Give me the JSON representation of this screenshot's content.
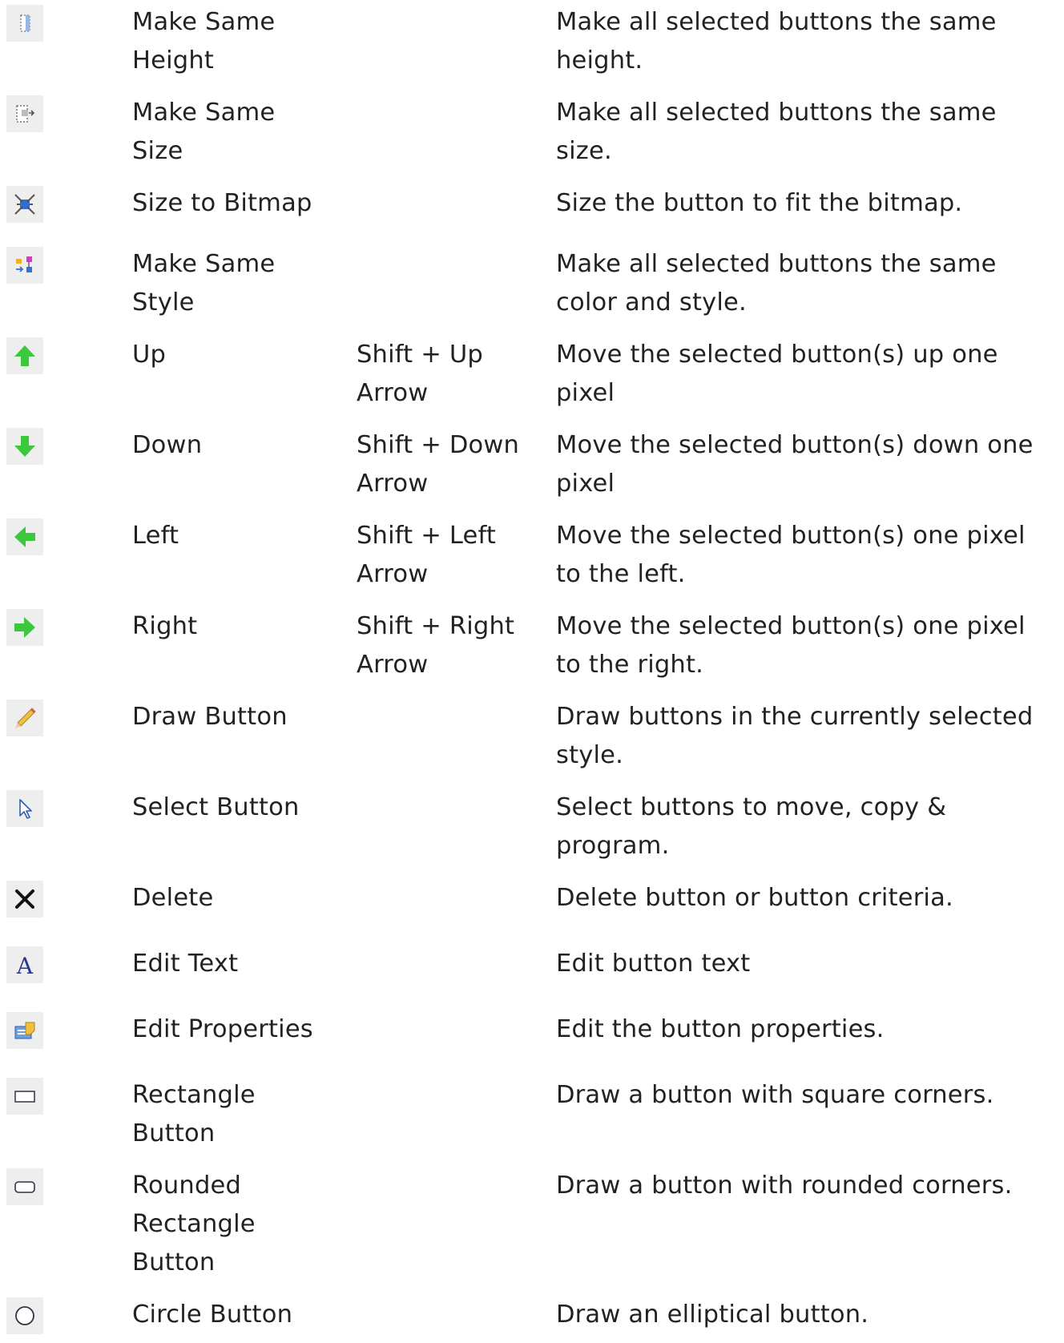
{
  "rows": [
    {
      "icon": "make-same-height-icon",
      "name": "Make Same Height",
      "shortcut": "",
      "description": "Make all selected buttons the same height."
    },
    {
      "icon": "make-same-size-icon",
      "name": "Make Same Size",
      "shortcut": "",
      "description": "Make all selected buttons the same size."
    },
    {
      "icon": "size-to-bitmap-icon",
      "name": "Size to Bitmap",
      "shortcut": "",
      "description": "Size the button to fit the bitmap."
    },
    {
      "icon": "make-same-style-icon",
      "name": "Make Same Style",
      "shortcut": "",
      "description": "Make all selected buttons the same color and style."
    },
    {
      "icon": "arrow-up-icon",
      "name": "Up",
      "shortcut": "Shift + Up Arrow",
      "description": "Move the selected button(s) up one pixel"
    },
    {
      "icon": "arrow-down-icon",
      "name": "Down",
      "shortcut": "Shift + Down Arrow",
      "description": "Move the selected button(s) down one pixel"
    },
    {
      "icon": "arrow-left-icon",
      "name": "Left",
      "shortcut": "Shift + Left Arrow",
      "description": "Move the selected button(s) one pixel to the left."
    },
    {
      "icon": "arrow-right-icon",
      "name": "Right",
      "shortcut": "Shift + Right Arrow",
      "description": "Move the selected button(s) one pixel to the right."
    },
    {
      "icon": "pencil-icon",
      "name": "Draw Button",
      "shortcut": "",
      "description": "Draw buttons in the currently selected style."
    },
    {
      "icon": "pointer-icon",
      "name": "Select Button",
      "shortcut": "",
      "description": "Select buttons to move, copy & program."
    },
    {
      "icon": "delete-x-icon",
      "name": "Delete",
      "shortcut": "",
      "description": "Delete button or button criteria."
    },
    {
      "icon": "text-a-icon",
      "name": "Edit Text",
      "shortcut": "",
      "description": "Edit button text"
    },
    {
      "icon": "properties-icon",
      "name": "Edit Properties",
      "shortcut": "",
      "description": "Edit the button properties."
    },
    {
      "icon": "rectangle-icon",
      "name": "Rectangle Button",
      "shortcut": "",
      "description": "Draw a button with square corners."
    },
    {
      "icon": "rounded-rectangle-icon",
      "name": "Rounded Rectangle Button",
      "shortcut": "",
      "description": "Draw a button with rounded corners."
    },
    {
      "icon": "circle-icon",
      "name": "Circle Button",
      "shortcut": "",
      "description": "Draw an elliptical button."
    }
  ],
  "colors": {
    "text": "#222222",
    "icon_bg": "#eeeeee",
    "arrow_green": "#3cc83c",
    "icon_blue": "#2f6fd0"
  }
}
